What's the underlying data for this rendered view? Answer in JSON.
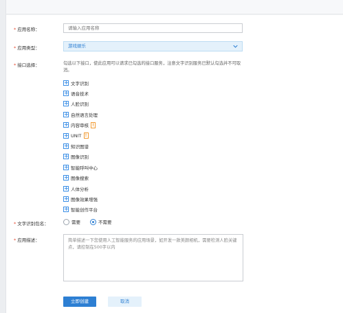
{
  "form": {
    "app_name": {
      "label": "应用名称：",
      "placeholder": "请输入应用名称"
    },
    "app_type": {
      "label": "应用类型：",
      "value": "游戏娱乐"
    },
    "api_select": {
      "label": "接口选择：",
      "hint": "勾选以下接口，使此应用可以请求已勾选的接口服务，注意文字识别服务已默认勾选并不可取消。",
      "items": [
        {
          "name": "文字识别"
        },
        {
          "name": "语音技术"
        },
        {
          "name": "人脸识别"
        },
        {
          "name": "自然语言处理"
        },
        {
          "name": "内容审核",
          "badge": "!"
        },
        {
          "name": "UNIT",
          "badge": "!"
        },
        {
          "name": "知识图谱"
        },
        {
          "name": "图像识别"
        },
        {
          "name": "智能呼叫中心"
        },
        {
          "name": "图像搜索"
        },
        {
          "name": "人体分析"
        },
        {
          "name": "图像效果增强"
        },
        {
          "name": "智能创作平台"
        }
      ]
    },
    "ocr_package": {
      "label": "文字识别包名：",
      "options": [
        {
          "label": "需要",
          "selected": false
        },
        {
          "label": "不需要",
          "selected": true
        }
      ]
    },
    "app_desc": {
      "label": "应用描述：",
      "placeholder": "简单描述一下您使用人工智能服务的应用场景，如开发一款美颜相机，需要检测人脸关键点，请控制在500字以内"
    },
    "required_mark": "*",
    "submit_label": "立即创建",
    "cancel_label": "取消"
  },
  "colors": {
    "accent": "#2d7fd3",
    "required": "#e84a2e",
    "warning": "#f29b33"
  }
}
